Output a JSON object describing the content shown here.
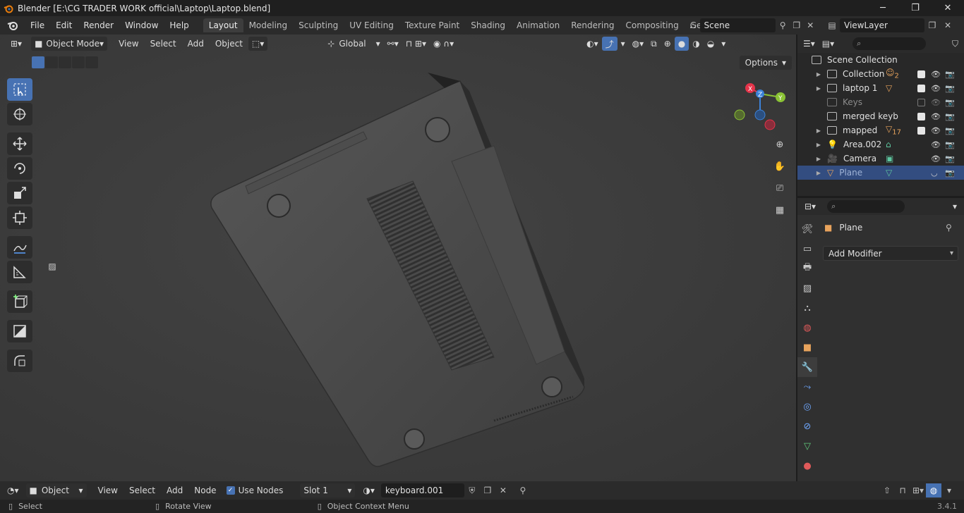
{
  "window": {
    "title": "Blender [E:\\CG TRADER WORK official\\Laptop\\Laptop.blend]",
    "controls": [
      "─",
      "❐",
      "✕"
    ]
  },
  "menu": {
    "items": [
      "File",
      "Edit",
      "Render",
      "Window",
      "Help"
    ]
  },
  "workspaces": {
    "tabs": [
      "Layout",
      "Modeling",
      "Sculpting",
      "UV Editing",
      "Texture Paint",
      "Shading",
      "Animation",
      "Rendering",
      "Compositing",
      "Geometry Node"
    ],
    "active": "Layout"
  },
  "scene": {
    "name": "Scene"
  },
  "view_layer": {
    "name": "ViewLayer"
  },
  "viewport": {
    "mode": "Object Mode",
    "menus": [
      "View",
      "Select",
      "Add",
      "Object"
    ],
    "transform_orientation": "Global",
    "options_label": "Options",
    "gizmo": {
      "x": "X",
      "y": "Y",
      "z": "Z"
    }
  },
  "outliner": {
    "root": "Scene Collection",
    "rows": [
      {
        "label": "Collection",
        "extra": "2",
        "checked": true,
        "dim": false,
        "selected": false
      },
      {
        "label": "laptop 1",
        "extra": "",
        "checked": true,
        "dim": false,
        "selected": false
      },
      {
        "label": "Keys",
        "extra": "",
        "checked": false,
        "dim": true,
        "selected": false
      },
      {
        "label": "merged keyb",
        "extra": "",
        "checked": true,
        "dim": false,
        "selected": false
      },
      {
        "label": "mapped",
        "extra": "17",
        "checked": true,
        "dim": false,
        "selected": false
      },
      {
        "label": "Area.002",
        "extra": "",
        "checked": null,
        "dim": false,
        "selected": false
      },
      {
        "label": "Camera",
        "extra": "",
        "checked": null,
        "dim": false,
        "selected": false
      },
      {
        "label": "Plane",
        "extra": "",
        "checked": null,
        "dim": false,
        "selected": true
      }
    ]
  },
  "properties": {
    "object_name": "Plane",
    "add_modifier": "Add Modifier"
  },
  "shader_header": {
    "editor_mode": "Object",
    "menus": [
      "View",
      "Select",
      "Add",
      "Node"
    ],
    "use_nodes_label": "Use Nodes",
    "use_nodes": true,
    "slot": "Slot 1",
    "material": "keyboard.001"
  },
  "status": {
    "hints": [
      "Select",
      "Rotate View",
      "Object Context Menu"
    ],
    "version": "3.4.1"
  },
  "colors": {
    "accent": "#4772b3",
    "selection": "#334d80",
    "viewport_bg": "#3d3d3d",
    "gizmo_x": "#e5344a",
    "gizmo_y": "#8bc335",
    "gizmo_z": "#3c82d8"
  }
}
